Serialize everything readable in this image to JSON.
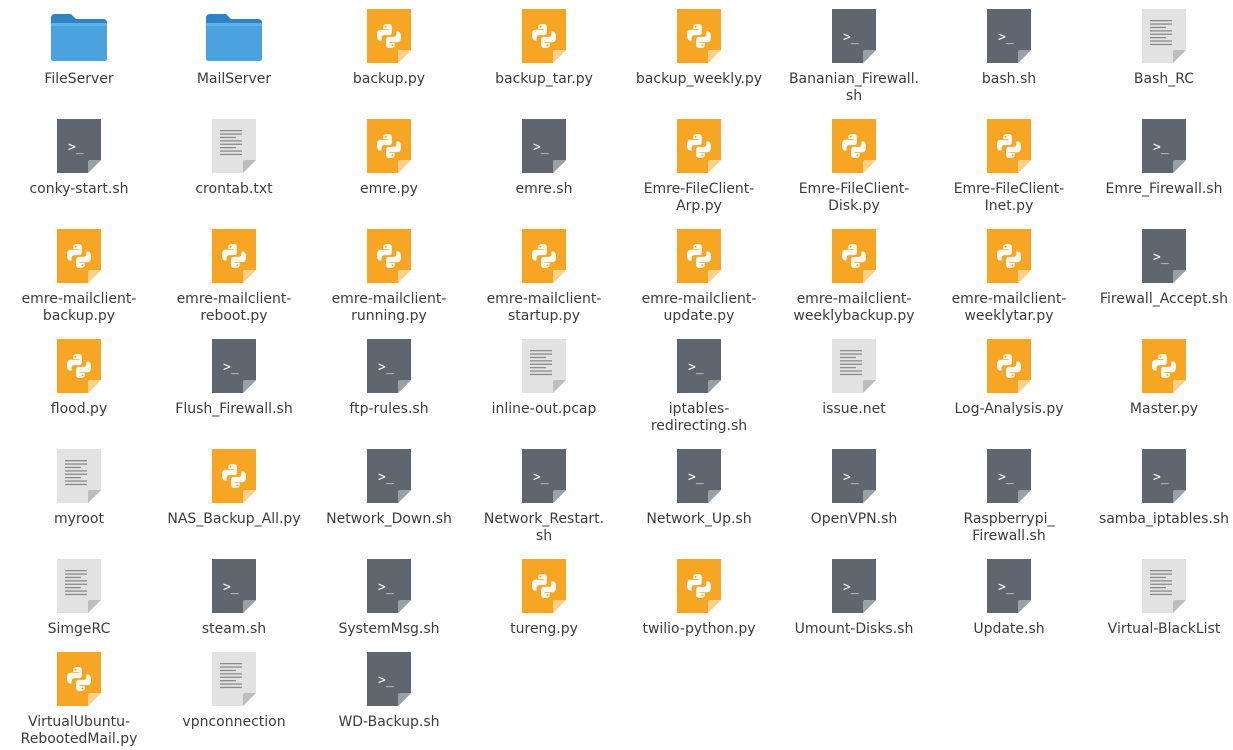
{
  "colors": {
    "folder": "#4aa3df",
    "python": "#f6a623",
    "shell": "#5f6670",
    "text": "#e2e2e2",
    "label": "#3c3c3c"
  },
  "files": [
    {
      "name": "FileServer",
      "type": "folder",
      "icon": "folder-icon"
    },
    {
      "name": "MailServer",
      "type": "folder",
      "icon": "folder-icon"
    },
    {
      "name": "backup.py",
      "type": "python",
      "icon": "python-file-icon"
    },
    {
      "name": "backup_tar.py",
      "type": "python",
      "icon": "python-file-icon"
    },
    {
      "name": "backup_weekly.py",
      "type": "python",
      "icon": "python-file-icon"
    },
    {
      "name": "Bananian_Firewall.\nsh",
      "type": "shell",
      "icon": "shell-script-icon"
    },
    {
      "name": "bash.sh",
      "type": "shell",
      "icon": "shell-script-icon"
    },
    {
      "name": "Bash_RC",
      "type": "text",
      "icon": "text-file-icon"
    },
    {
      "name": "conky-start.sh",
      "type": "shell",
      "icon": "shell-script-icon"
    },
    {
      "name": "crontab.txt",
      "type": "text",
      "icon": "text-file-icon"
    },
    {
      "name": "emre.py",
      "type": "python",
      "icon": "python-file-icon"
    },
    {
      "name": "emre.sh",
      "type": "shell",
      "icon": "shell-script-icon"
    },
    {
      "name": "Emre-FileClient-\nArp.py",
      "type": "python",
      "icon": "python-file-icon"
    },
    {
      "name": "Emre-FileClient-\nDisk.py",
      "type": "python",
      "icon": "python-file-icon"
    },
    {
      "name": "Emre-FileClient-\nInet.py",
      "type": "python",
      "icon": "python-file-icon"
    },
    {
      "name": "Emre_Firewall.sh",
      "type": "shell",
      "icon": "shell-script-icon"
    },
    {
      "name": "emre-mailclient-\nbackup.py",
      "type": "python",
      "icon": "python-file-icon"
    },
    {
      "name": "emre-mailclient-\nreboot.py",
      "type": "python",
      "icon": "python-file-icon"
    },
    {
      "name": "emre-mailclient-\nrunning.py",
      "type": "python",
      "icon": "python-file-icon"
    },
    {
      "name": "emre-mailclient-\nstartup.py",
      "type": "python",
      "icon": "python-file-icon"
    },
    {
      "name": "emre-mailclient-\nupdate.py",
      "type": "python",
      "icon": "python-file-icon"
    },
    {
      "name": "emre-mailclient-\nweeklybackup.py",
      "type": "python",
      "icon": "python-file-icon"
    },
    {
      "name": "emre-mailclient-\nweeklytar.py",
      "type": "python",
      "icon": "python-file-icon"
    },
    {
      "name": "Firewall_Accept.sh",
      "type": "shell",
      "icon": "shell-script-icon"
    },
    {
      "name": "flood.py",
      "type": "python",
      "icon": "python-file-icon"
    },
    {
      "name": "Flush_Firewall.sh",
      "type": "shell",
      "icon": "shell-script-icon"
    },
    {
      "name": "ftp-rules.sh",
      "type": "shell",
      "icon": "shell-script-icon"
    },
    {
      "name": "inline-out.pcap",
      "type": "text",
      "icon": "text-file-icon"
    },
    {
      "name": "iptables-\nredirecting.sh",
      "type": "shell",
      "icon": "shell-script-icon"
    },
    {
      "name": "issue.net",
      "type": "text",
      "icon": "text-file-icon"
    },
    {
      "name": "Log-Analysis.py",
      "type": "python",
      "icon": "python-file-icon"
    },
    {
      "name": "Master.py",
      "type": "python",
      "icon": "python-file-icon"
    },
    {
      "name": "myroot",
      "type": "text",
      "icon": "text-file-icon"
    },
    {
      "name": "NAS_Backup_All.py",
      "type": "python",
      "icon": "python-file-icon"
    },
    {
      "name": "Network_Down.sh",
      "type": "shell",
      "icon": "shell-script-icon"
    },
    {
      "name": "Network_Restart.\nsh",
      "type": "shell",
      "icon": "shell-script-icon"
    },
    {
      "name": "Network_Up.sh",
      "type": "shell",
      "icon": "shell-script-icon"
    },
    {
      "name": "OpenVPN.sh",
      "type": "shell",
      "icon": "shell-script-icon"
    },
    {
      "name": "Raspberrypi_\nFirewall.sh",
      "type": "shell",
      "icon": "shell-script-icon"
    },
    {
      "name": "samba_iptables.sh",
      "type": "shell",
      "icon": "shell-script-icon"
    },
    {
      "name": "SimgeRC",
      "type": "text",
      "icon": "text-file-icon"
    },
    {
      "name": "steam.sh",
      "type": "shell",
      "icon": "shell-script-icon"
    },
    {
      "name": "SystemMsg.sh",
      "type": "shell",
      "icon": "shell-script-icon"
    },
    {
      "name": "tureng.py",
      "type": "python",
      "icon": "python-file-icon"
    },
    {
      "name": "twilio-python.py",
      "type": "python",
      "icon": "python-file-icon"
    },
    {
      "name": "Umount-Disks.sh",
      "type": "shell",
      "icon": "shell-script-icon"
    },
    {
      "name": "Update.sh",
      "type": "shell",
      "icon": "shell-script-icon"
    },
    {
      "name": "Virtual-BlackList",
      "type": "text",
      "icon": "text-file-icon"
    },
    {
      "name": "VirtualUbuntu-\nRebootedMail.py",
      "type": "python",
      "icon": "python-file-icon"
    },
    {
      "name": "vpnconnection",
      "type": "text",
      "icon": "text-file-icon"
    },
    {
      "name": "WD-Backup.sh",
      "type": "shell",
      "icon": "shell-script-icon"
    }
  ]
}
